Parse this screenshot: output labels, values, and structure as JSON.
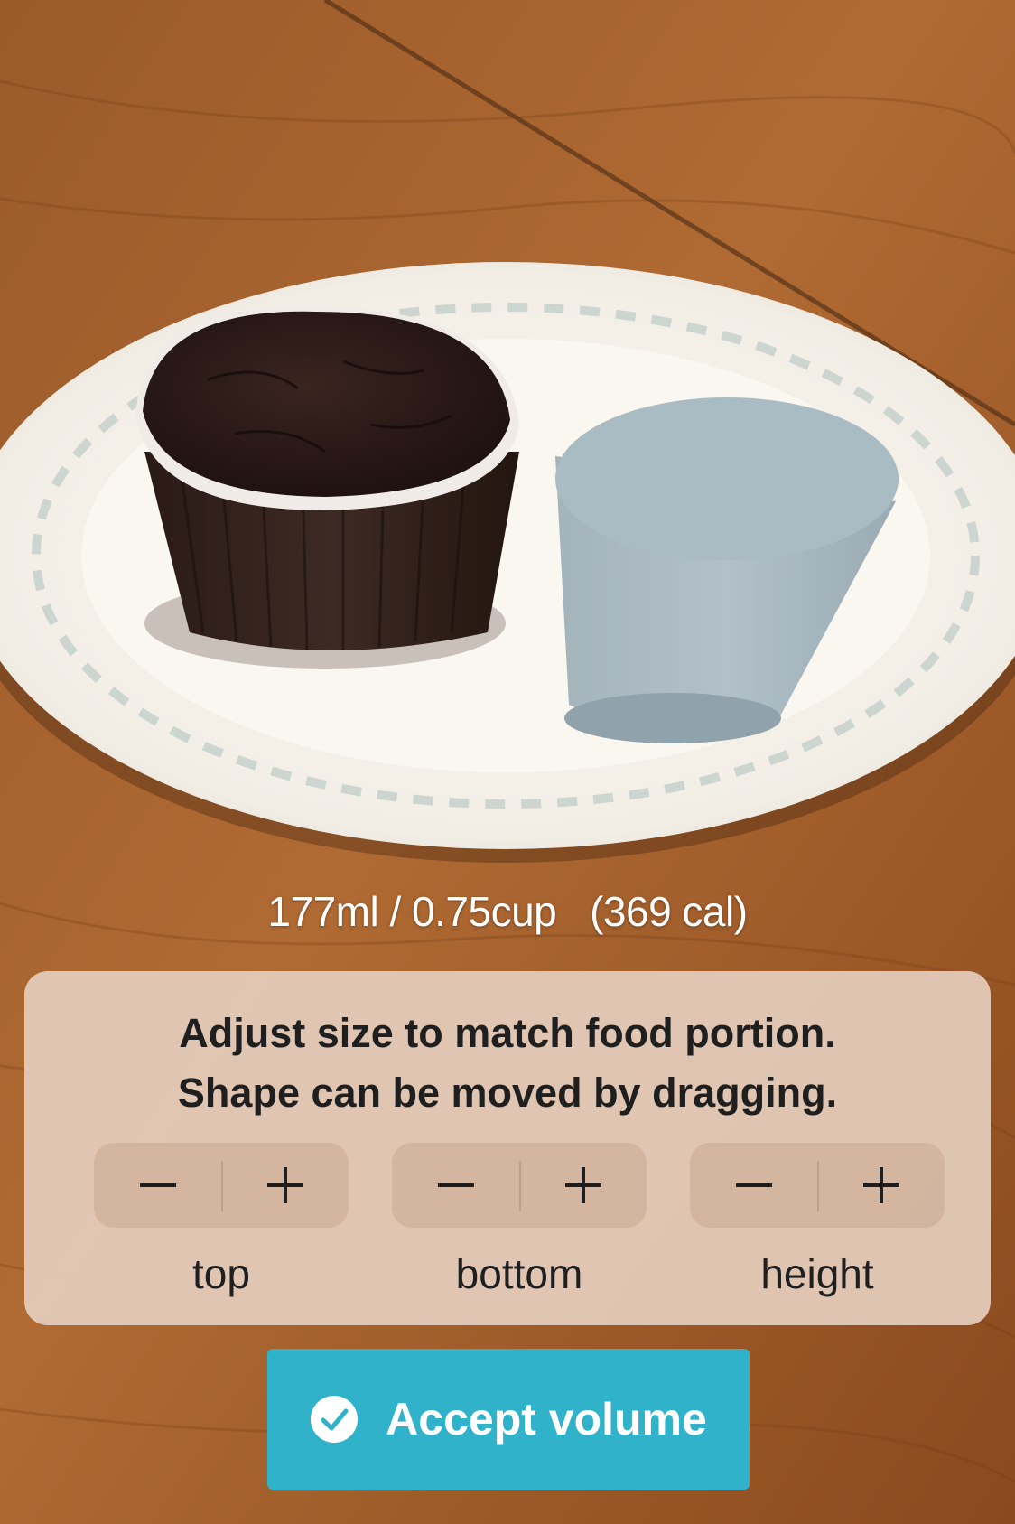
{
  "camera_view": {
    "description_icons": [
      "muffin-image",
      "plate-image",
      "volume-cylinder-shape"
    ]
  },
  "readout": {
    "text": "177ml / 0.75cup   (369 cal)"
  },
  "panel": {
    "instruction_line1": "Adjust size to match food portion.",
    "instruction_line2": "Shape can be moved by dragging.",
    "controls": [
      {
        "label": "top",
        "minus_icon": "minus-icon",
        "plus_icon": "plus-icon"
      },
      {
        "label": "bottom",
        "minus_icon": "minus-icon",
        "plus_icon": "plus-icon"
      },
      {
        "label": "height",
        "minus_icon": "minus-icon",
        "plus_icon": "plus-icon"
      }
    ]
  },
  "accept_button": {
    "label": "Accept volume",
    "icon": "checkmark-circle-icon",
    "color": "#30b2cb"
  }
}
